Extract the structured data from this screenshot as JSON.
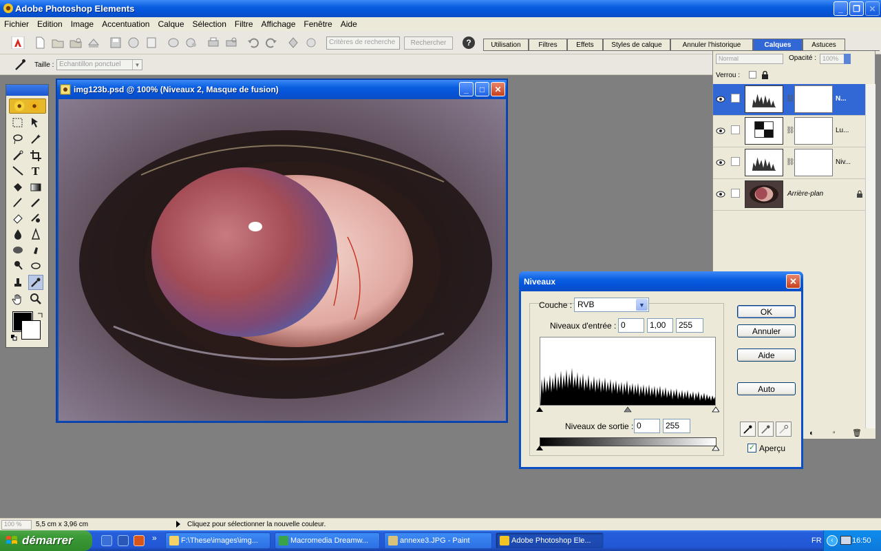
{
  "app": {
    "title": "Adobe Photoshop Elements",
    "window_buttons": {
      "minimize": "_",
      "maximize": "❐",
      "close": "✕"
    }
  },
  "menu": [
    "Fichier",
    "Edition",
    "Image",
    "Accentuation",
    "Calque",
    "Sélection",
    "Filtre",
    "Affichage",
    "Fenêtre",
    "Aide"
  ],
  "shortcuts": {
    "search_placeholder": "Critères de recherche",
    "search_button": "Rechercher",
    "help": "?"
  },
  "palette_well": {
    "tabs": [
      "Utilisation",
      "Filtres",
      "Effets",
      "Styles de calque",
      "Annuler l'historique",
      "Calques",
      "Astuces"
    ],
    "active": "Calques"
  },
  "options_bar": {
    "size_label": "Taille :",
    "size_value": "Echantillon ponctuel"
  },
  "document": {
    "title": "img123b.psd @ 100% (Niveaux 2, Masque de fusion)"
  },
  "layers": {
    "blend_mode": "Normal",
    "opacity_label": "Opacité :",
    "opacity_value": "100%",
    "lock_label": "Verrou :",
    "items": [
      {
        "name": "N...",
        "type": "levels",
        "selected": true
      },
      {
        "name": "Lu...",
        "type": "brightness",
        "selected": false
      },
      {
        "name": "Niv...",
        "type": "levels",
        "selected": false
      },
      {
        "name": "Arrière-plan",
        "type": "background",
        "selected": false
      }
    ]
  },
  "levels_dialog": {
    "title": "Niveaux",
    "channel_label": "Couche :",
    "channel_value": "RVB",
    "input_label": "Niveaux d'entrée :",
    "input_black": "0",
    "input_gamma": "1,00",
    "input_white": "255",
    "output_label": "Niveaux de sortie :",
    "output_black": "0",
    "output_white": "255",
    "buttons": {
      "ok": "OK",
      "cancel": "Annuler",
      "help": "Aide",
      "auto": "Auto"
    },
    "preview_label": "Aperçu",
    "preview_checked": true,
    "close": "✕"
  },
  "status": {
    "zoom": "100 %",
    "doc_size": "5,5 cm x 3,96 cm",
    "message": "Cliquez pour sélectionner la nouvelle couleur."
  },
  "taskbar": {
    "start": "démarrer",
    "more": "»",
    "tasks": [
      {
        "label": "F:\\These\\images\\img...",
        "active": false
      },
      {
        "label": "Macromedia Dreamw...",
        "active": false
      },
      {
        "label": "annexe3.JPG - Paint",
        "active": false
      },
      {
        "label": "Adobe Photoshop Ele...",
        "active": true
      }
    ],
    "language": "FR",
    "clock": "16:50"
  }
}
